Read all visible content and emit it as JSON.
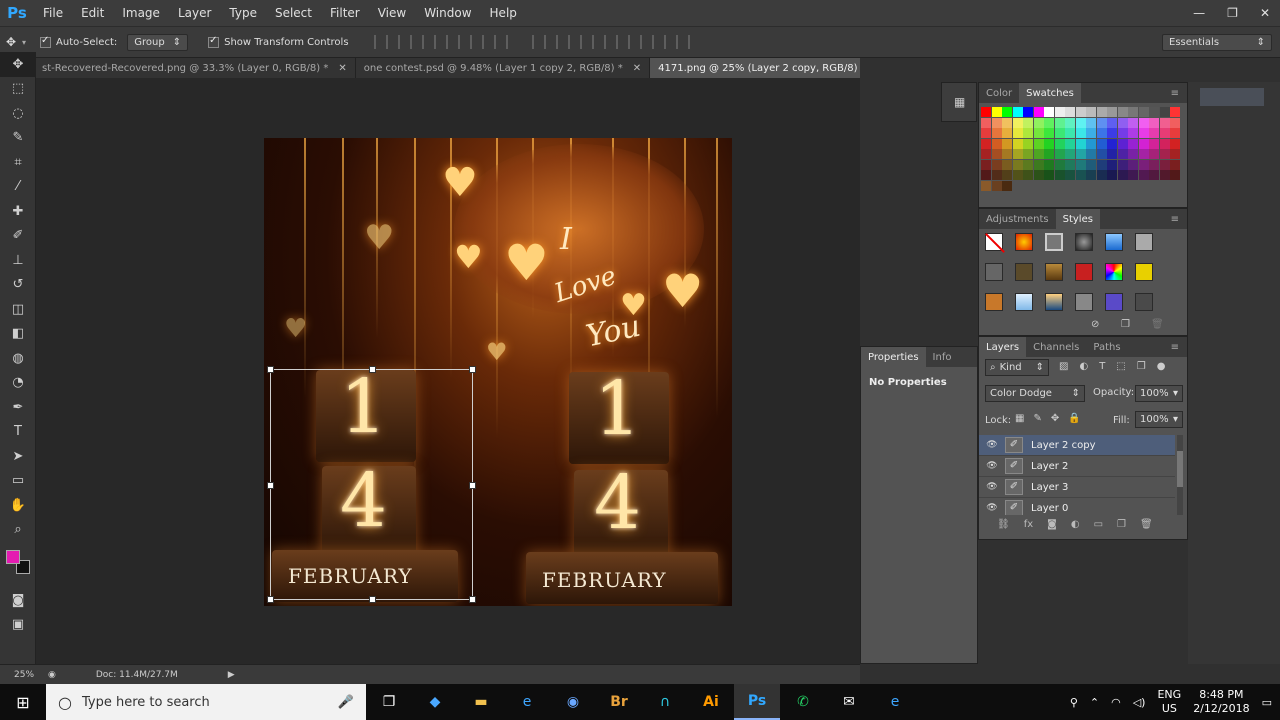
{
  "app": {
    "logo": "Ps"
  },
  "menu": [
    "File",
    "Edit",
    "Image",
    "Layer",
    "Type",
    "Select",
    "Filter",
    "View",
    "Window",
    "Help"
  ],
  "window_controls": [
    "—",
    "❐",
    "✕"
  ],
  "options": {
    "auto_select_label": "Auto-Select:",
    "auto_select_value": "Group",
    "show_transform_label": "Show Transform Controls",
    "workspace": "Essentials"
  },
  "tabs": [
    {
      "title": "st-Recovered-Recovered.png @ 33.3% (Layer 0, RGB/8) *",
      "active": false
    },
    {
      "title": "one contest.psd @ 9.48% (Layer 1 copy 2, RGB/8) *",
      "active": false
    },
    {
      "title": "4171.png @ 25% (Layer 2 copy, RGB/8) *",
      "active": true
    }
  ],
  "tools": [
    "move",
    "marquee",
    "lasso",
    "quick-select",
    "crop",
    "eyedropper",
    "healing",
    "brush",
    "stamp",
    "history-brush",
    "eraser",
    "gradient",
    "blur",
    "dodge",
    "pen",
    "type",
    "path-select",
    "shape",
    "hand",
    "zoom"
  ],
  "artwork": {
    "digits_left": [
      "1",
      "4"
    ],
    "digits_right": [
      "1",
      "4"
    ],
    "month": "FEBRUARY",
    "script_text": [
      "I",
      "Love",
      "You"
    ]
  },
  "status": {
    "zoom": "25%",
    "doc": "Doc: 11.4M/27.7M"
  },
  "panels": {
    "color_tab": "Color",
    "swatches_tab": "Swatches",
    "adjustments_tab": "Adjustments",
    "styles_tab": "Styles",
    "properties_tab": "Properties",
    "info_tab": "Info",
    "properties_text": "No Properties",
    "layers_tab": "Layers",
    "channels_tab": "Channels",
    "paths_tab": "Paths",
    "filter_kind": "Kind",
    "blend_mode": "Color Dodge",
    "opacity_label": "Opacity:",
    "opacity_value": "100%",
    "lock_label": "Lock:",
    "fill_label": "Fill:",
    "fill_value": "100%",
    "layers": [
      {
        "name": "Layer 2 copy",
        "selected": true
      },
      {
        "name": "Layer 2",
        "selected": false
      },
      {
        "name": "Layer 3",
        "selected": false
      },
      {
        "name": "Layer 0",
        "selected": false
      }
    ]
  },
  "taskbar": {
    "search_placeholder": "Type here to search",
    "lang": "ENG",
    "region": "US",
    "time": "8:48 PM",
    "date": "2/12/2018",
    "apps": [
      "task-view",
      "store",
      "file-explorer",
      "edge",
      "app5",
      "bridge",
      "app7",
      "illustrator",
      "photoshop",
      "whatsapp",
      "mail",
      "ie"
    ]
  },
  "colors": {
    "foreground": "#e41bb1",
    "background": "#111111",
    "selection": "#4e5e7a"
  }
}
